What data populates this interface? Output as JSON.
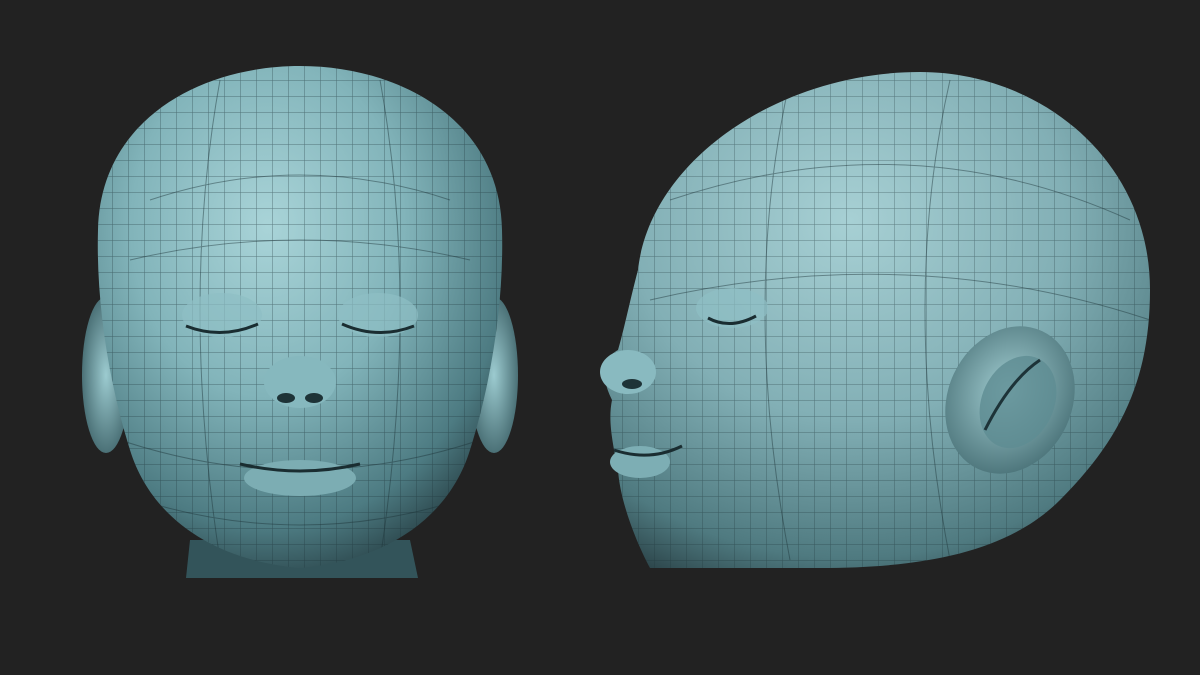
{
  "scene": {
    "background": "#222222",
    "mesh_color": "#7fb0b7",
    "mesh_highlight": "#a8d2d6",
    "mesh_shadow": "#27434a",
    "wire_color": "#1d3338",
    "views": [
      {
        "name": "front"
      },
      {
        "name": "side"
      }
    ]
  }
}
